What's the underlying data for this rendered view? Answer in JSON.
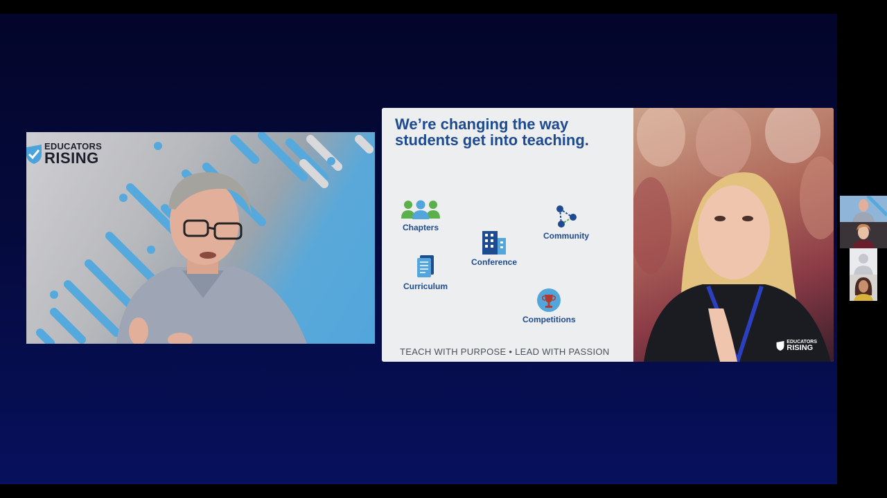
{
  "speaker": {
    "logo_line1": "EDUCATORS",
    "logo_line2": "RISING"
  },
  "slide": {
    "headline": "We’re changing the way students get into teaching.",
    "features": [
      {
        "label": "Chapters",
        "icon": "people-group-icon"
      },
      {
        "label": "Community",
        "icon": "network-icon"
      },
      {
        "label": "Conference",
        "icon": "building-icon"
      },
      {
        "label": "Curriculum",
        "icon": "document-icon"
      },
      {
        "label": "Competitions",
        "icon": "trophy-icon"
      }
    ],
    "tagline": "TEACH WITH PURPOSE • LEAD WITH PASSION",
    "photo_logo_line1": "EDUCATORS",
    "photo_logo_line2": "RISING"
  },
  "colors": {
    "brand_blue": "#1e4a8f",
    "accent_light_blue": "#52a6dc",
    "green": "#5bb04b"
  }
}
